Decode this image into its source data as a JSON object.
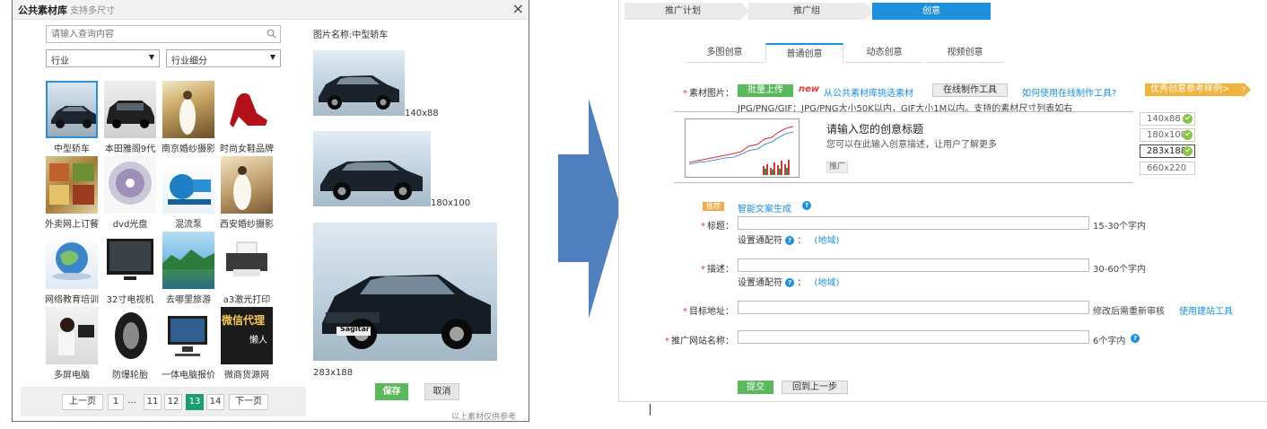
{
  "library": {
    "title": "公共素材库",
    "subtitle": "支持多尺寸",
    "close": "×",
    "search_placeholder": "请输入查询内容",
    "industry": "行业",
    "subindustry": "行业细分",
    "thumbs": [
      {
        "caption": "中型轿车"
      },
      {
        "caption": "本田雅阁9代"
      },
      {
        "caption": "南京婚纱摄影"
      },
      {
        "caption": "时尚女鞋品牌"
      },
      {
        "caption": "外卖网上订餐"
      },
      {
        "caption": "dvd光盘"
      },
      {
        "caption": "混流泵"
      },
      {
        "caption": "西安婚纱摄影"
      },
      {
        "caption": "网络教育培训"
      },
      {
        "caption": "32寸电视机"
      },
      {
        "caption": "去哪里旅游"
      },
      {
        "caption": "a3激光打印"
      },
      {
        "caption": "多屏电脑"
      },
      {
        "caption": "防爆轮胎"
      },
      {
        "caption": "一体电脑报价"
      },
      {
        "caption": "微商货源网"
      }
    ],
    "ad_text": {
      "line1": "微信代理",
      "line2": "懒人"
    },
    "car_plate": "Sagitar",
    "pager": {
      "prev": "上一页",
      "p1": "1",
      "dots": "...",
      "p11": "11",
      "p12": "12",
      "p13": "13",
      "p14": "14",
      "next": "下一页"
    },
    "preview_name": "图片名称:中型轿车",
    "sizes": {
      "s1": "140x88",
      "s2": "180x100",
      "s3": "283x188"
    },
    "save": "保存",
    "cancel": "取消",
    "footnote": "以上素材仅供参考"
  },
  "creative": {
    "steps": {
      "s1": "推广计划",
      "s2": "推广组",
      "s3": "创意"
    },
    "tabs": {
      "t1": "多图创意",
      "t2": "普通创意",
      "t3": "动态创意",
      "t4": "视频创意"
    },
    "image_label": "素材图片：",
    "batch_upload": "批量上传",
    "new_tag": "new",
    "from_library": "从公共素材库挑选素材",
    "online_tool": "在线制作工具",
    "how_to": "如何使用在线制作工具?",
    "reference": "优秀创意参考样例>",
    "format_hint": "JPG/PNG/GIF：JPG/PNG大小50K以内，GIF大小1M以内。支持的素材尺寸列表如右",
    "preview_title": "请输入您的创意标题",
    "preview_desc": "您可以在此输入创意描述，让用户了解更多",
    "preview_tag": "推广",
    "size_tabs": {
      "s1": "140x88",
      "s2": "180x100",
      "s3": "283x188",
      "s4": "660x220"
    },
    "recommend": "推荐",
    "smart_copy": "智能文案生成",
    "title_label": "标题：",
    "title_hint": "15-30个字内",
    "wildcard": "设置通配符",
    "region": "(地域)",
    "desc_label": "描述：",
    "desc_hint": "30-60个字内",
    "url_label": "目标地址：",
    "url_hint": "修改后需重新审核",
    "site_tool": "使用建站工具",
    "site_label": "推广网站名称：",
    "site_hint": "6个字内",
    "submit": "提交",
    "back": "回到上一步"
  },
  "colors": {
    "accent": "#1d8fdc",
    "green": "#5cb85c",
    "pager_current": "#1b9e6f",
    "orange": "#f0b43c",
    "red": "#e4393c",
    "arrow": "#4a7ab8"
  }
}
